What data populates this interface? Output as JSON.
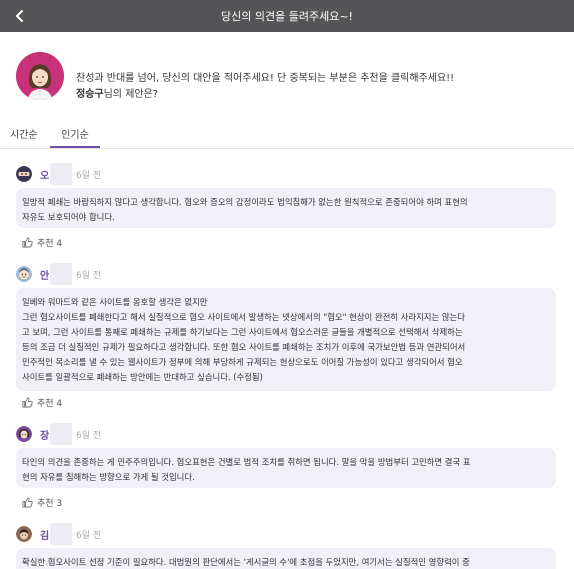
{
  "header": {
    "title": "당신의 의견을 들려주세요~!",
    "back_icon": "chevron-left-icon",
    "background": "#555558"
  },
  "intro": {
    "line1": "찬성과 반대를 넘어, 당신의 대안을 적어주세요! 단 중복되는 부분은 추천을 클릭해주세요!!",
    "user_name": "정승구",
    "line2_suffix": "님의 제안은?"
  },
  "tabs": [
    {
      "label": "시간순",
      "active": false
    },
    {
      "label": "인기순",
      "active": true
    }
  ],
  "accent_color": "#6c4ea3",
  "comments": [
    {
      "name": "오",
      "time": "6일 전",
      "avatar_icon": "ninja-avatar-icon",
      "text": "일방적 폐쇄는 바람직하지 않다고 생각합니다. 혐오와 증오의 감정이라도 법익침해가 없는한 원칙적으로 존중되어야 하며 표현의\n자유도 보호되어야 합니다.",
      "like_label": "추천 4"
    },
    {
      "name": "안",
      "time": "6일 전",
      "avatar_icon": "smiling-avatar-icon",
      "text": "일베와 워마드와 같은 사이트를 옹호할 생각은 없지만\n그런 혐오사이트를 폐쇄한다고 해서 실질적으로 혐오 사이트에서 발생하는 넷상에서의 \"혐오\" 현상이 완전히 사라지지는 않는다\n고 보며, 그런 사이트를 통째로 폐쇄하는 규제를 하기보다는 그런 사이트에서 혐오스러운 글들을 개별적으로 선택해서 삭제하는\n등의 조금 더 실질적인 규제가 필요하다고 생각합니다. 또한 혐오 사이트를 폐쇄하는 조치가 이후에 국가보안법 등과 연관되어서\n민주적인 목소리를 낼 수 있는 웹사이트가 정부에 의해 부당하게 규제되는 현상으로도 이어질 가능성이 있다고 생각되어서 혐오\n사이트를 일괄적으로 폐쇄하는 방안에는 반대하고 싶습니다. (수정됨)",
      "like_label": "추천 4"
    },
    {
      "name": "장",
      "time": "6일 전",
      "avatar_icon": "woman-avatar-icon",
      "text": "타인의 의견을 존중하는 게 민주주의입니다. 혐오표현은 건별로 법적 조치를 취하면 됩니다. 말을 막을 방법부터 고민하면 결국 표\n현의 자유를 침해하는 방향으로 가게 될 것입니다.",
      "like_label": "추천 3"
    },
    {
      "name": "김",
      "time": "6일 전",
      "avatar_icon": "man-avatar-icon",
      "text": "확실한 혐오사이트 선정 기준이 필요하다. 대법원의 판단에서는 '게시글의 수'에 초점을 두었지만, 여기서는 실질적인 영향력이 중",
      "like_label": ""
    }
  ]
}
